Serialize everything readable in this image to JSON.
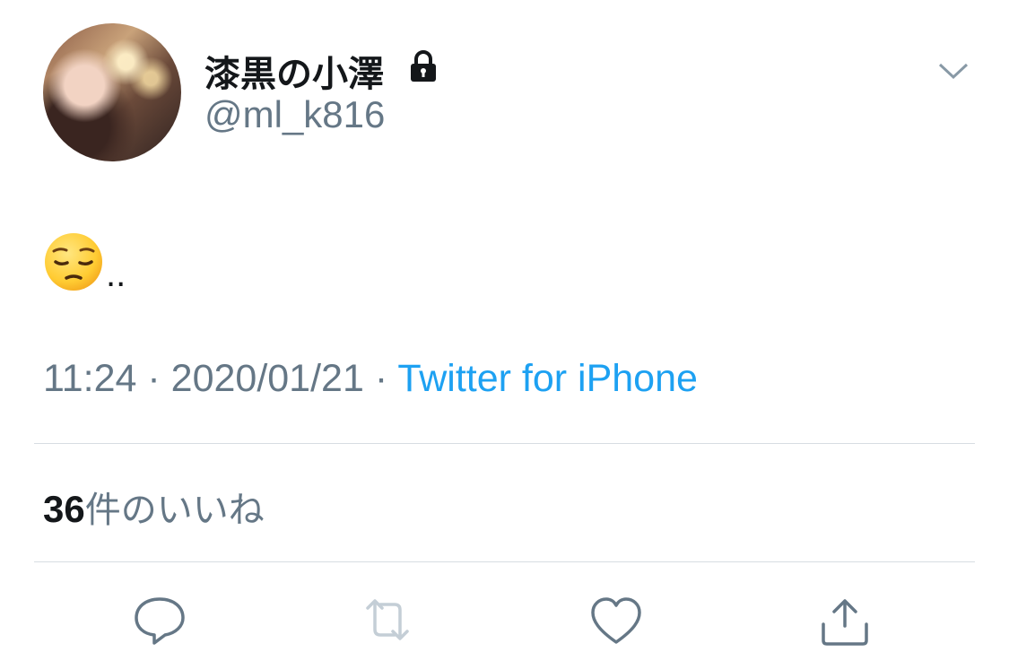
{
  "user": {
    "display_name": "漆黒の小澤",
    "handle": "@ml_k816",
    "protected_icon": "lock-icon",
    "avatar": "profile-photo"
  },
  "tweet": {
    "emoji": "pensive-face",
    "text_suffix": ".."
  },
  "meta": {
    "time": "11:24",
    "separator": "·",
    "date": "2020/01/21",
    "source": "Twitter for iPhone"
  },
  "stats": {
    "likes_count": "36",
    "likes_label": "件のいいね"
  },
  "actions": {
    "reply_icon": "reply-icon",
    "retweet_icon": "retweet-icon",
    "like_icon": "heart-icon",
    "share_icon": "share-icon"
  },
  "colors": {
    "link": "#1da1f2",
    "secondary_text": "#657786",
    "divider": "#d7dde2",
    "icon": "#657786",
    "retweet_disabled": "#c4ced6"
  }
}
